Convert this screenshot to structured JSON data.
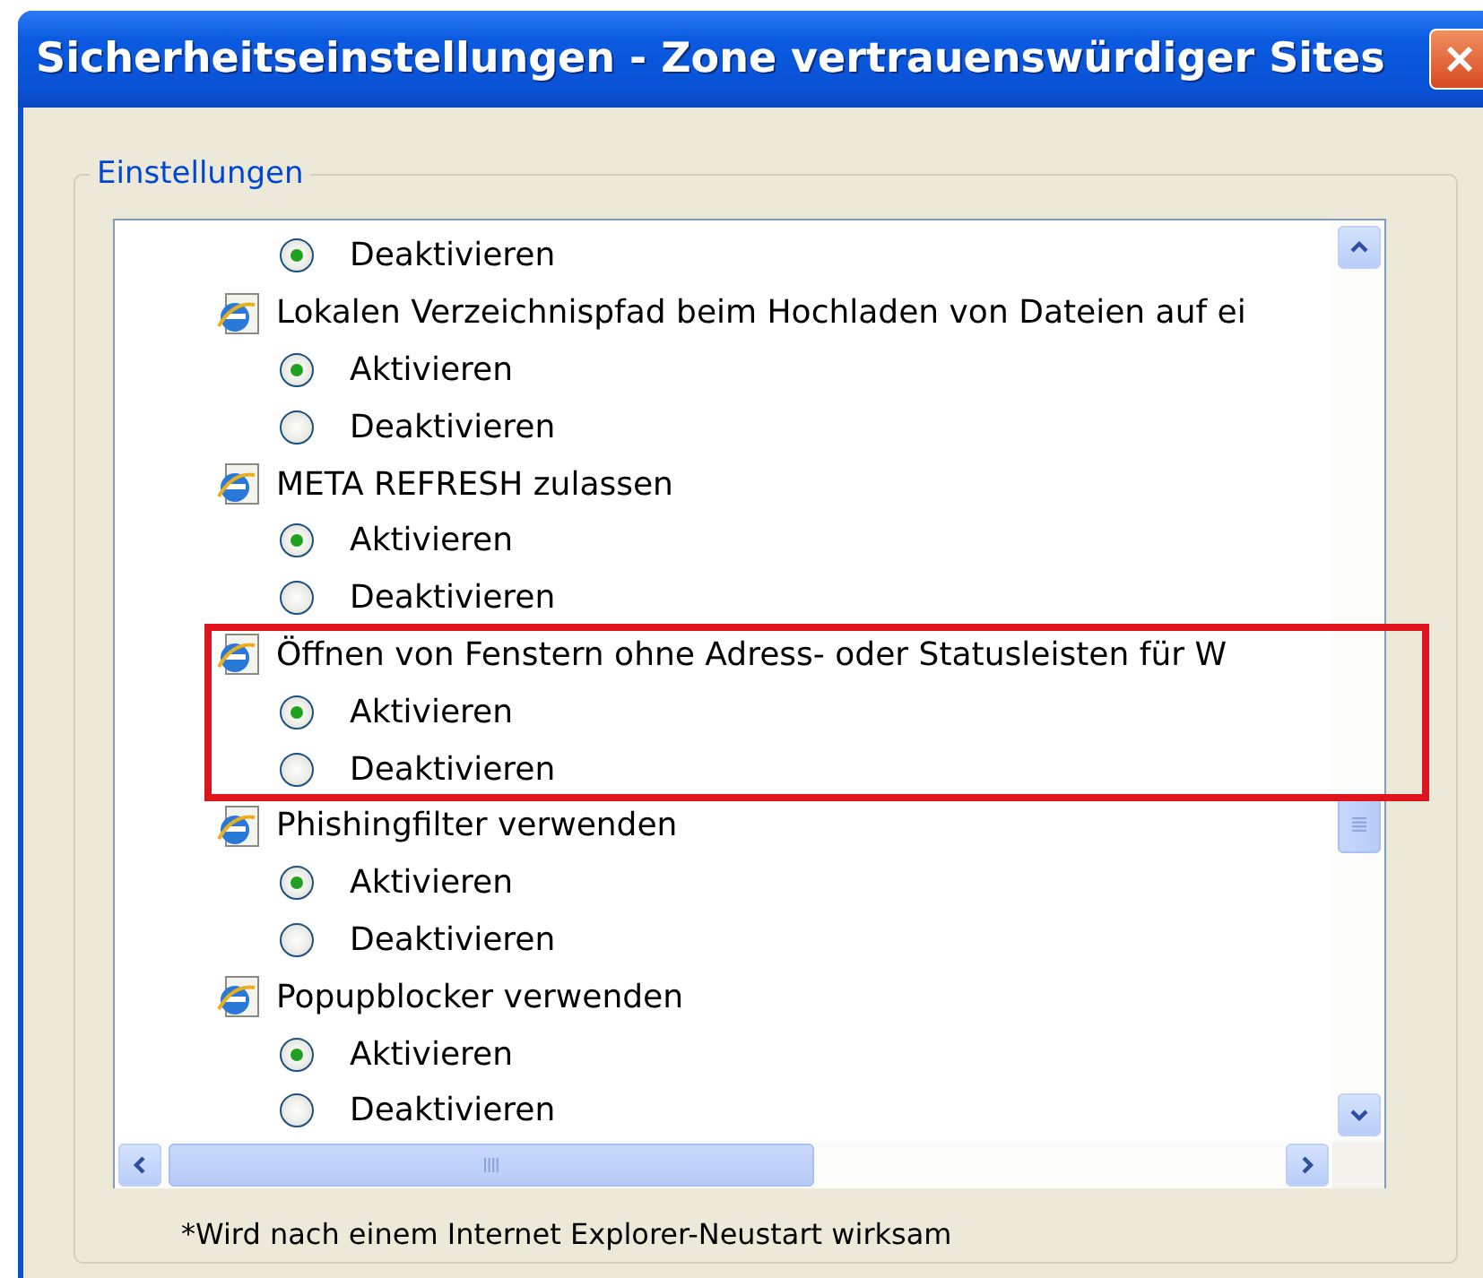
{
  "window": {
    "title": "Sicherheitseinstellungen - Zone vertrauenswürdiger Sites"
  },
  "group": {
    "label": "Einstellungen"
  },
  "settings": [
    {
      "highlighted": false,
      "options": [
        {
          "label": "Deaktivieren",
          "selected": true
        }
      ]
    },
    {
      "title": "Lokalen Verzeichnispfad beim Hochladen von Dateien auf ei",
      "highlighted": false,
      "options": [
        {
          "label": "Aktivieren",
          "selected": true
        },
        {
          "label": "Deaktivieren",
          "selected": false
        }
      ]
    },
    {
      "title": "META REFRESH zulassen",
      "highlighted": false,
      "options": [
        {
          "label": "Aktivieren",
          "selected": true
        },
        {
          "label": "Deaktivieren",
          "selected": false
        }
      ]
    },
    {
      "title": "Öffnen von Fenstern ohne Adress- oder Statusleisten für W",
      "highlighted": true,
      "options": [
        {
          "label": "Aktivieren",
          "selected": true
        },
        {
          "label": "Deaktivieren",
          "selected": false
        }
      ]
    },
    {
      "title": "Phishingfilter verwenden",
      "highlighted": false,
      "options": [
        {
          "label": "Aktivieren",
          "selected": true
        },
        {
          "label": "Deaktivieren",
          "selected": false
        }
      ]
    },
    {
      "title": "Popupblocker verwenden",
      "highlighted": false,
      "options": [
        {
          "label": "Aktivieren",
          "selected": true
        },
        {
          "label": "Deaktivieren",
          "selected": false
        }
      ]
    }
  ],
  "footnote": "*Wird nach einem Internet Explorer-Neustart wirksam"
}
